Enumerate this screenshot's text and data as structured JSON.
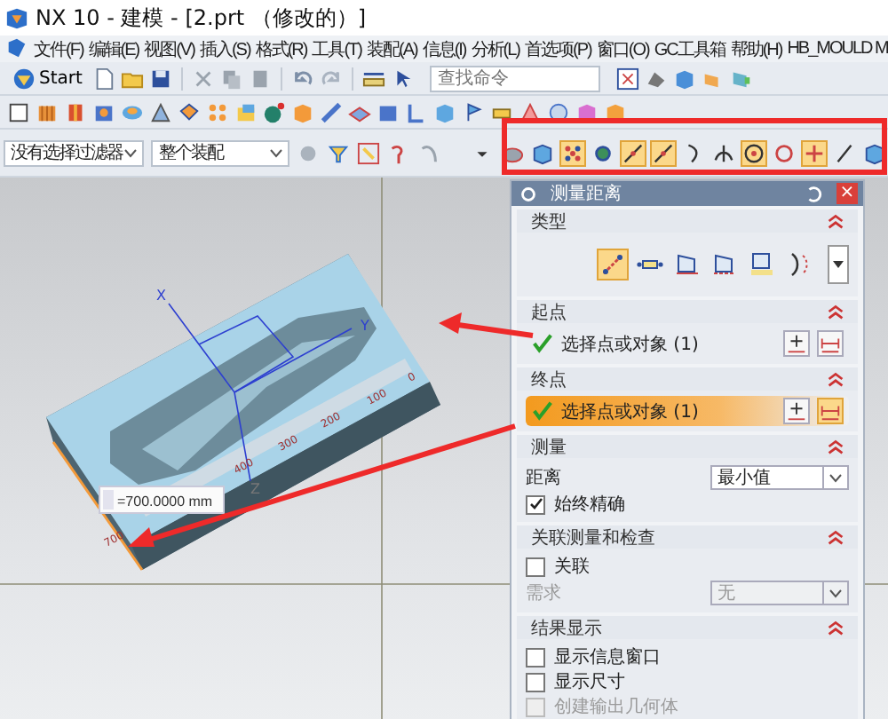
{
  "window": {
    "title": "NX 10 - 建模 - [2.prt （修改的）]"
  },
  "menu": [
    "文件(F)",
    "编辑(E)",
    "视图(V)",
    "插入(S)",
    "格式(R)",
    "工具(T)",
    "装配(A)",
    "信息(I)",
    "分析(L)",
    "首选项(P)",
    "窗口(O)",
    "GC工具箱",
    "帮助(H)",
    "HB_MOULD M"
  ],
  "toolbar": {
    "start": "Start",
    "search": {
      "placeholder": "查找命令"
    }
  },
  "filter_bar": {
    "selection_filter": "没有选择过滤器",
    "scope": "整个装配"
  },
  "snap_toolbar": [
    {
      "kind": "caret",
      "selected": false
    },
    {
      "kind": "sphere",
      "selected": false
    },
    {
      "kind": "cube",
      "selected": false
    },
    {
      "kind": "dots",
      "selected": true
    },
    {
      "kind": "gear",
      "selected": false
    },
    {
      "kind": "line",
      "selected": true
    },
    {
      "kind": "line",
      "selected": true
    },
    {
      "kind": "curve",
      "selected": false
    },
    {
      "kind": "junction",
      "selected": false
    },
    {
      "kind": "target",
      "selected": true
    },
    {
      "kind": "circle",
      "selected": false
    },
    {
      "kind": "plus",
      "selected": true
    },
    {
      "kind": "slash",
      "selected": false
    },
    {
      "kind": "cube",
      "selected": false
    }
  ],
  "viewport": {
    "axes": [
      "X",
      "Y",
      "Z"
    ],
    "ruler_labels": [
      "0",
      "100",
      "200",
      "300",
      "400",
      "700"
    ],
    "measurement": "=700.0000 mm"
  },
  "dialog": {
    "title": "测量距离",
    "close": "×",
    "sections": [
      {
        "kind": "types",
        "title": "类型",
        "types": [
          {
            "selected": true
          },
          {
            "selected": false
          },
          {
            "selected": false
          },
          {
            "selected": false
          },
          {
            "selected": false
          },
          {
            "selected": false
          }
        ]
      },
      {
        "kind": "point",
        "title": "起点",
        "label": "选择点或对象 (1)",
        "active": false
      },
      {
        "kind": "point",
        "title": "终点",
        "label": "选择点或对象 (1)",
        "active": true
      },
      {
        "kind": "measure",
        "title": "测量",
        "field_label": "距离",
        "value": "最小值",
        "disabled": false,
        "option": {
          "label": "始终精确",
          "checked": true
        }
      },
      {
        "kind": "association",
        "title": "关联测量和检查",
        "option": {
          "label": "关联",
          "checked": false
        },
        "field_label": "需求",
        "value": "无",
        "disabled": true
      },
      {
        "kind": "results",
        "title": "结果显示",
        "options": [
          {
            "label": "显示信息窗口",
            "checked": false,
            "disabled": false
          },
          {
            "label": "显示尺寸",
            "checked": false,
            "disabled": false
          },
          {
            "label": "创建输出几何体",
            "checked": false,
            "disabled": true
          }
        ]
      }
    ]
  }
}
